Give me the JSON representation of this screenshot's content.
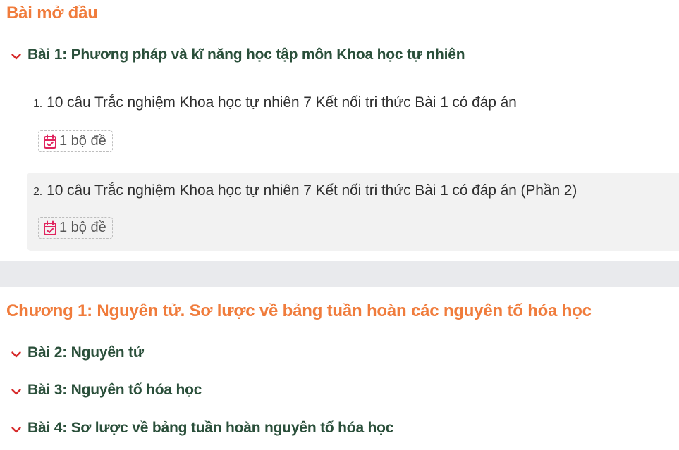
{
  "sections": [
    {
      "title": "Bài mở đầu",
      "lessons": [
        {
          "label": "Bài 1: Phương pháp và kĩ năng học tập môn Khoa học tự nhiên",
          "expanded": true,
          "quizzes": [
            {
              "number": "1.",
              "title": "10 câu Trắc nghiệm Khoa học tự nhiên 7 Kết nối tri thức Bài 1 có đáp án",
              "badge": "1 bộ đề"
            },
            {
              "number": "2.",
              "title": "10 câu Trắc nghiệm Khoa học tự nhiên 7 Kết nối tri thức Bài 1 có đáp án (Phần 2)",
              "badge": "1 bộ đề"
            }
          ]
        }
      ]
    },
    {
      "title": "Chương 1: Nguyên tử. Sơ lược về bảng tuần hoàn các nguyên tố hóa học",
      "lessons": [
        {
          "label": "Bài 2: Nguyên tử"
        },
        {
          "label": "Bài 3: Nguyên tố hóa học"
        },
        {
          "label": "Bài 4: Sơ lược về bảng tuần hoàn nguyên tố hóa học"
        }
      ]
    }
  ],
  "colors": {
    "section_title": "#f07c3c",
    "lesson_label": "#2a4f3a",
    "chevron": "#d62b2b",
    "calendar_icon": "#e0245e",
    "divider": "#e9eaed",
    "alt_row_bg": "#f2f2f2"
  },
  "icons": {
    "chevron": "chevron-down-icon",
    "badge": "calendar-check-icon"
  }
}
